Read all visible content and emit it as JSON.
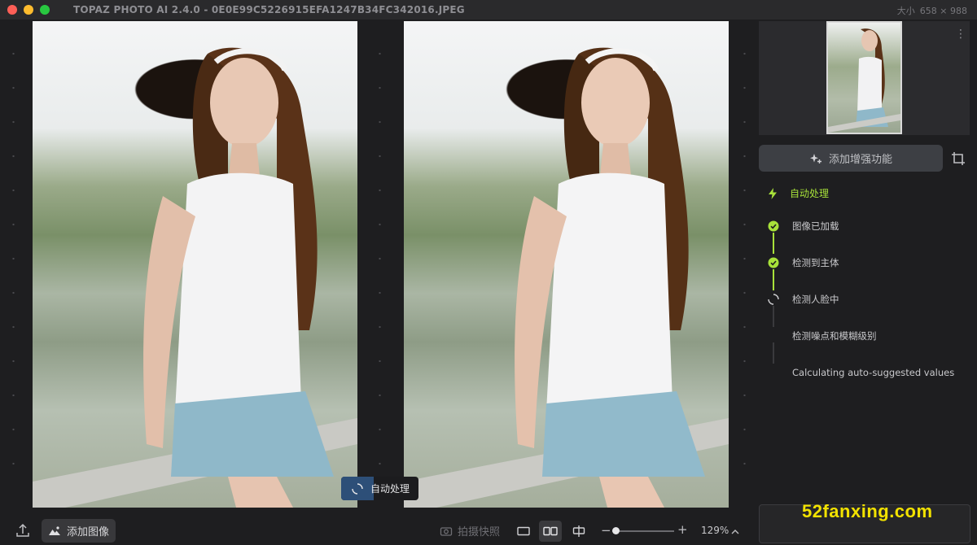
{
  "window": {
    "title": "TOPAZ PHOTO AI 2.4.0 - 0E0E99C5226915EFA1247B34FC342016.JPEG",
    "size_label": "大小",
    "size_value": "658 × 988"
  },
  "panel": {
    "enhance_button": "添加增强功能",
    "auto_header": "自动处理",
    "steps": [
      {
        "label": "图像已加载",
        "state": "done"
      },
      {
        "label": "检测到主体",
        "state": "done"
      },
      {
        "label": "检测人脸中",
        "state": "running"
      },
      {
        "label": "检测噪点和模糊级别",
        "state": "pending"
      },
      {
        "label": "Calculating auto-suggested values",
        "state": "pending"
      }
    ],
    "accent_color": "#a8e23a"
  },
  "toolbar": {
    "add_image": "添加图像",
    "snapshot": "拍摄快照",
    "zoom_value": "129%",
    "zoom_level": 0.05
  },
  "overlay": {
    "auto_process": "自动处理"
  },
  "watermark": "52fanxing.com"
}
